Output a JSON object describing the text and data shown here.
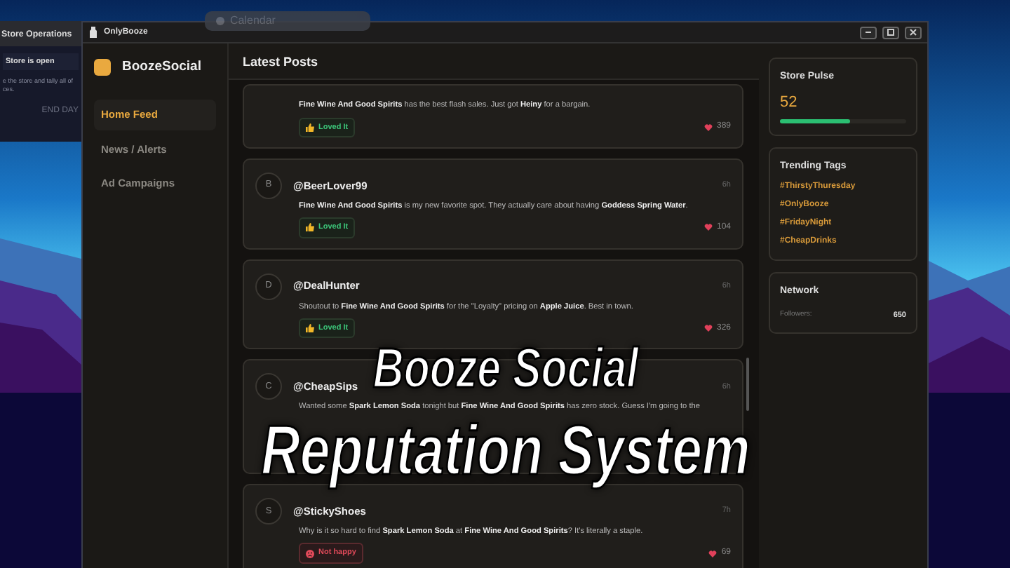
{
  "desktop": {
    "calendar": {
      "label": "Calendar"
    },
    "store_operations": {
      "title": "Store Operations",
      "status": "Store is open",
      "description": [
        "e the store and tally all of",
        "ces."
      ],
      "button": "END DAY"
    }
  },
  "window": {
    "title": "OnlyBooze"
  },
  "brand": {
    "name": "BoozeSocial"
  },
  "nav": [
    {
      "label": "Home Feed",
      "selected": true
    },
    {
      "label": "News / Alerts",
      "selected": false
    },
    {
      "label": "Ad Campaigns",
      "selected": false
    }
  ],
  "feed": {
    "title": "Latest Posts",
    "posts": [
      {
        "text": "**Fine Wine  And Good Spirits** has the best flash sales. Just got **Heiny** for a bargain.",
        "reaction": {
          "kind": "loved",
          "label": "Loved It"
        },
        "likes": "389"
      },
      {
        "avatar": "B",
        "author": "@BeerLover99",
        "time": "6h",
        "text": "**Fine Wine  And Good Spirits** is my new favorite spot. They actually care about having **Goddess Spring Water**.",
        "reaction": {
          "kind": "loved",
          "label": "Loved It"
        },
        "likes": "104"
      },
      {
        "avatar": "D",
        "author": "@DealHunter",
        "time": "6h",
        "text": "Shoutout to **Fine Wine  And Good Spirits** for the \"Loyalty\" pricing on **Apple Juice**. Best in town.",
        "reaction": {
          "kind": "loved",
          "label": "Loved It"
        },
        "likes": "326"
      },
      {
        "avatar": "C",
        "author": "@CheapSips",
        "time": "6h",
        "text": "Wanted some **Spark Lemon Soda** tonight but **Fine Wine  And Good Spirits** has zero stock. Guess I'm going to the"
      },
      {
        "avatar": "S",
        "author": "@StickyShoes",
        "time": "7h",
        "text": "Why is it so hard to find **Spark Lemon Soda** at **Fine Wine  And Good Spirits**? It's literally a staple.",
        "reaction": {
          "kind": "unhappy",
          "label": "Not happy"
        },
        "likes": "69"
      }
    ]
  },
  "pulse": {
    "title": "Store Pulse",
    "value": "52",
    "level": 0.55
  },
  "trending": {
    "title": "Trending Tags",
    "tags": [
      "#ThirstyThuresday",
      "#OnlyBooze",
      "#FridayNight",
      "#CheapDrinks"
    ]
  },
  "network": {
    "title": "Network",
    "label": "Followers:",
    "value": "650"
  },
  "overlay_title": [
    "Booze Social",
    "Reputation System"
  ]
}
